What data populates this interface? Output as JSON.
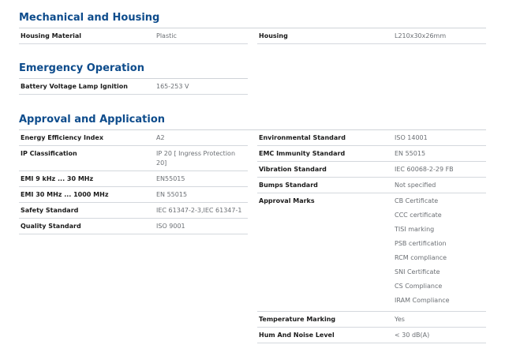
{
  "sections": {
    "mechanical": {
      "title": "Mechanical and Housing",
      "left": [
        {
          "label": "Housing Material",
          "value": "Plastic"
        }
      ],
      "right": [
        {
          "label": "Housing",
          "value": "L210x30x26mm"
        }
      ]
    },
    "emergency": {
      "title": "Emergency Operation",
      "left": [
        {
          "label": "Battery Voltage Lamp Ignition",
          "value": "165-253 V"
        }
      ]
    },
    "approval": {
      "title": "Approval and Application",
      "left": [
        {
          "label": "Energy Efficiency Index",
          "value": "A2"
        },
        {
          "label": "IP Classification",
          "value": "IP 20  [ Ingress Protection 20]"
        },
        {
          "label": "EMI 9 kHz ... 30 MHz",
          "value": "EN55015"
        },
        {
          "label": "EMI 30 MHz ... 1000 MHz",
          "value": "EN 55015"
        },
        {
          "label": "Safety Standard",
          "value": "IEC 61347-2-3,IEC 61347-1"
        },
        {
          "label": "Quality Standard",
          "value": "ISO 9001"
        }
      ],
      "right": [
        {
          "label": "Environmental Standard",
          "value": "ISO 14001"
        },
        {
          "label": "EMC Immunity Standard",
          "value": "EN 55015"
        },
        {
          "label": "Vibration Standard",
          "value": "IEC 60068-2-29 FB"
        },
        {
          "label": "Bumps Standard",
          "value": "Not specified"
        }
      ],
      "approval_marks": {
        "label": "Approval Marks",
        "values": [
          "CB Certificate",
          "CCC certificate",
          "TISI marking",
          "PSB certification",
          "RCM compliance",
          "SNI Certificate",
          "CS Compliance",
          "IRAM Compliance"
        ]
      },
      "right_after": [
        {
          "label": "Temperature Marking",
          "value": "Yes"
        },
        {
          "label": "Hum And Noise Level",
          "value": "< 30 dB(A)"
        }
      ]
    }
  }
}
